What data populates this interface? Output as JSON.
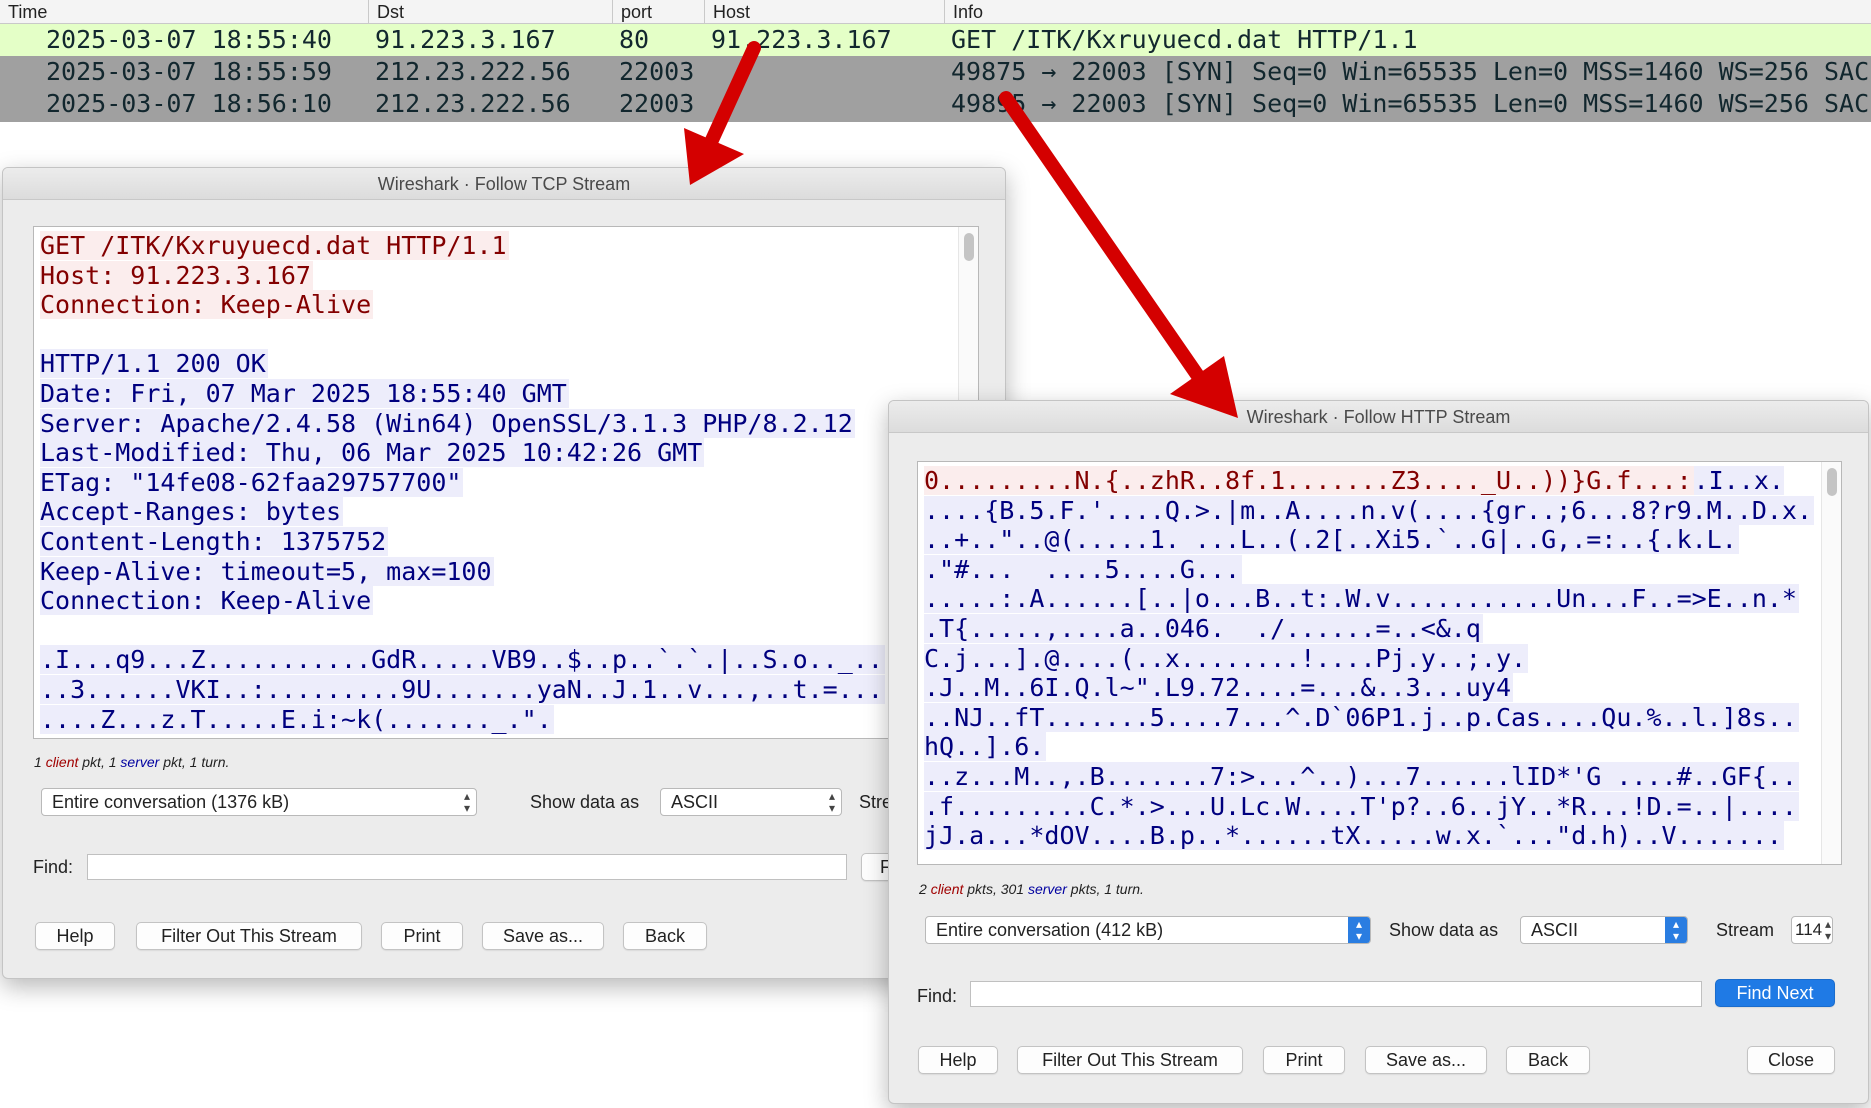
{
  "packet_list": {
    "columns": [
      "Time",
      "Dst",
      "port",
      "Host",
      "Info"
    ],
    "rows": [
      {
        "time": "2025-03-07 18:55:40",
        "dst": "91.223.3.167",
        "port": "80",
        "host": "91.223.3.167",
        "info": "GET /ITK/Kxruyuecd.dat HTTP/1.1"
      },
      {
        "time": "2025-03-07 18:55:59",
        "dst": "212.23.222.56",
        "port": "22003",
        "host": "",
        "info": "49875 → 22003 [SYN] Seq=0 Win=65535 Len=0 MSS=1460 WS=256 SAC"
      },
      {
        "time": "2025-03-07 18:56:10",
        "dst": "212.23.222.56",
        "port": "22003",
        "host": "",
        "info": "49895 → 22003 [SYN] Seq=0 Win=65535 Len=0 MSS=1460 WS=256 SAC"
      }
    ]
  },
  "tcp_dialog": {
    "title": "Wireshark · Follow TCP Stream",
    "lines": [
      {
        "type": "c",
        "text": "GET /ITK/Kxruyuecd.dat HTTP/1.1"
      },
      {
        "type": "c",
        "text": "Host: 91.223.3.167"
      },
      {
        "type": "c",
        "text": "Connection: Keep-Alive"
      },
      {
        "type": "blank",
        "text": ""
      },
      {
        "type": "s",
        "text": "HTTP/1.1 200 OK"
      },
      {
        "type": "s",
        "text": "Date: Fri, 07 Mar 2025 18:55:40 GMT"
      },
      {
        "type": "s",
        "text": "Server: Apache/2.4.58 (Win64) OpenSSL/3.1.3 PHP/8.2.12"
      },
      {
        "type": "s",
        "text": "Last-Modified: Thu, 06 Mar 2025 10:42:26 GMT"
      },
      {
        "type": "s",
        "text": "ETag: \"14fe08-62faa29757700\""
      },
      {
        "type": "s",
        "text": "Accept-Ranges: bytes"
      },
      {
        "type": "s",
        "text": "Content-Length: 1375752"
      },
      {
        "type": "s",
        "text": "Keep-Alive: timeout=5, max=100"
      },
      {
        "type": "s",
        "text": "Connection: Keep-Alive"
      },
      {
        "type": "blank",
        "text": ""
      },
      {
        "type": "s",
        "text": ".I...q9...Z...........GdR.....VB9..$..p..`.`.|..S.o.._.."
      },
      {
        "type": "s",
        "text": "..3......VKI..:.........9U.......yaN..J.1..v...,..t.=..."
      },
      {
        "type": "s",
        "text": "....Z...z.T.....E.i:~k(......._.\"."
      }
    ],
    "summary": {
      "client_count": "1",
      "client_word": "client",
      "client_suffix": "pkt,",
      "server_count": "1",
      "server_word": "server",
      "server_suffix": "pkt, 1 turn."
    },
    "conversation_select": "Entire conversation (1376 kB)",
    "show_data_label": "Show data as",
    "show_data_value": "ASCII",
    "stream_label": "Stre",
    "find_label": "Find:",
    "find_value": "",
    "find_next_partial": "Fi",
    "buttons": {
      "help": "Help",
      "filter_out": "Filter Out This Stream",
      "print": "Print",
      "save_as": "Save as...",
      "back": "Back"
    }
  },
  "http_dialog": {
    "title": "Wireshark · Follow HTTP Stream",
    "lines": [
      {
        "type": "c",
        "text": "0.........N.{..zhR..8f.1.......Z3...._U..))}G.f...:",
        "tail": ".I..x."
      },
      {
        "type": "s",
        "text": "....{B.5.F.'....Q.>.|m..A....n.v(....{gr..;6...8?r9.M..D.x."
      },
      {
        "type": "s",
        "text": "..+..\"..@(.....1. ...L..(.2[..Xi5.`..G|..G,.=:..{.k.L."
      },
      {
        "type": "s",
        "text": ".\"#...  ....5....G..."
      },
      {
        "type": "s",
        "text": ".....:.A......[..|o...B..t:.W.v...........Un...F..=>E..n.*"
      },
      {
        "type": "s",
        "text": ".T{.....,....a..046.  ./......=..<&.q"
      },
      {
        "type": "s",
        "text": "C.j...].@....(..x........!....Pj.y..;.y."
      },
      {
        "type": "s",
        "text": ".J..M..6I.Q.l~\".L9.72....=...&..3...uy4"
      },
      {
        "type": "s",
        "text": "..NJ..fT.......5....7...^.D`06P1.j..p.Cas....Qu.%..l.]8s.."
      },
      {
        "type": "s",
        "text": "hQ..].6."
      },
      {
        "type": "s",
        "text": "..z...M..,.B.......7:>...^..)...7......lID*'G ....#..GF{.."
      },
      {
        "type": "s",
        "text": ".f.........C.*.>...U.Lc.W....T'p?..6..jY..*R...!D.=..|...."
      },
      {
        "type": "s",
        "text": "jJ.a...*dOV....B.p..*......tX.....w.x.`...\"d.h)..V......."
      }
    ],
    "summary": {
      "client_count": "2",
      "client_word": "client",
      "client_suffix": "pkts,",
      "server_count": "301",
      "server_word": "server",
      "server_suffix": "pkts, 1 turn."
    },
    "conversation_select": "Entire conversation (412 kB)",
    "show_data_label": "Show data as",
    "show_data_value": "ASCII",
    "stream_label": "Stream",
    "stream_value": "114",
    "find_label": "Find:",
    "find_value": "",
    "find_next": "Find Next",
    "buttons": {
      "help": "Help",
      "filter_out": "Filter Out This Stream",
      "print": "Print",
      "save_as": "Save as...",
      "back": "Back",
      "close": "Close"
    }
  },
  "colors": {
    "client_text": "#830000",
    "client_bg": "#fbeded",
    "server_text": "#00007f",
    "server_bg": "#ededfb",
    "selected_row": "#e4ffc7",
    "grey_row": "#a0a0a0",
    "arrow": "#d40000",
    "primary_button": "#1f7ae5"
  },
  "icons": {
    "select_arrows": "up-down-chevron-icon",
    "annotation_arrow": "red-arrow-icon"
  }
}
